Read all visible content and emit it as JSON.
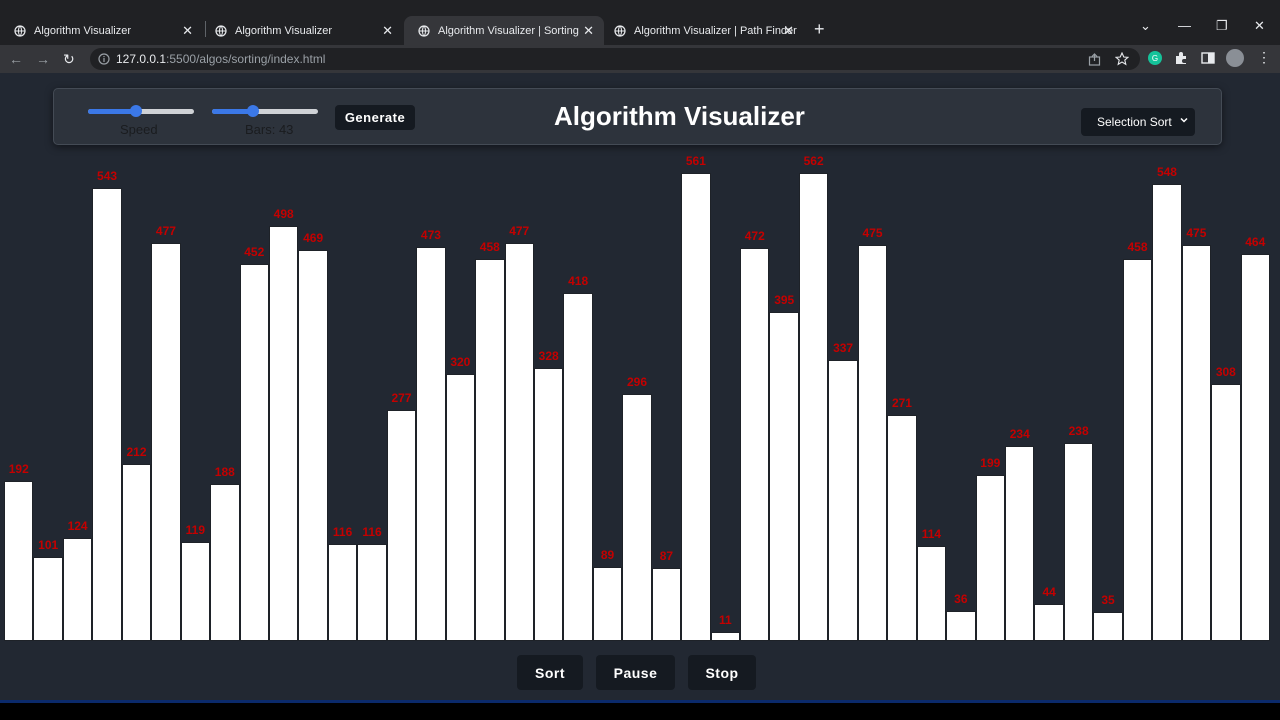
{
  "tabs": [
    {
      "title": "Algorithm Visualizer",
      "active": false
    },
    {
      "title": "Algorithm Visualizer",
      "active": false
    },
    {
      "title": "Algorithm Visualizer | Sorting",
      "active": true
    },
    {
      "title": "Algorithm Visualizer | Path Finder",
      "active": false
    }
  ],
  "url": {
    "host": "127.0.0.1",
    "rest": ":5500/algos/sorting/index.html"
  },
  "header": {
    "speed_label": "Speed",
    "speed_value": 0.45,
    "bars_label": "Bars: 43",
    "bars_value": 0.39,
    "generate_label": "Generate",
    "title": "Algorithm Visualizer",
    "algorithm_selected": "Selection Sort"
  },
  "controls": {
    "sort_label": "Sort",
    "pause_label": "Pause",
    "stop_label": "Stop"
  },
  "colors": {
    "bar": "#ffffff",
    "value_text": "#c40000",
    "accent": "#3b78e7",
    "page_bg": "#222832"
  },
  "chart_data": {
    "type": "bar",
    "values": [
      192,
      101,
      124,
      543,
      212,
      477,
      119,
      188,
      452,
      498,
      469,
      116,
      116,
      277,
      473,
      320,
      458,
      477,
      328,
      418,
      89,
      296,
      87,
      561,
      11,
      472,
      395,
      562,
      337,
      475,
      271,
      114,
      36,
      199,
      234,
      44,
      238,
      35,
      458,
      548,
      475,
      308,
      464
    ]
  }
}
